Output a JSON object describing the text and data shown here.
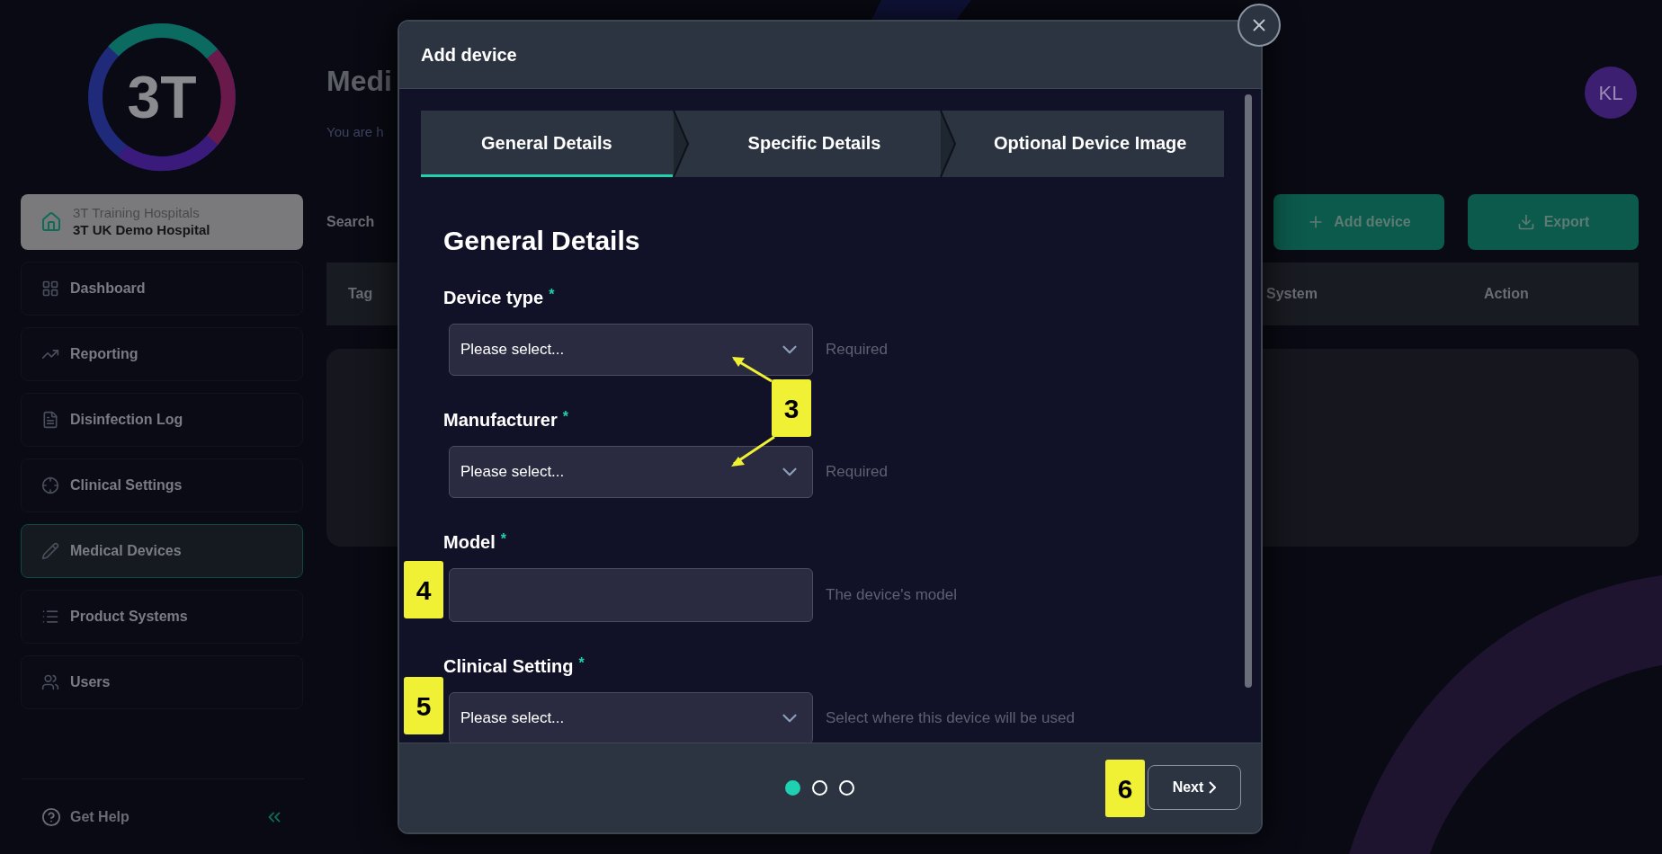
{
  "sidebar": {
    "logo_text": "3T",
    "hospital": {
      "group": "3T Training Hospitals",
      "name": "3T UK Demo Hospital"
    },
    "items": [
      {
        "label": "Dashboard",
        "selected": false
      },
      {
        "label": "Reporting",
        "selected": false
      },
      {
        "label": "Disinfection Log",
        "selected": false
      },
      {
        "label": "Clinical Settings",
        "selected": false
      },
      {
        "label": "Medical Devices",
        "selected": true
      },
      {
        "label": "Product Systems",
        "selected": false
      },
      {
        "label": "Users",
        "selected": false
      }
    ],
    "help": "Get Help"
  },
  "page": {
    "title": "Medi",
    "subtitle": "You are h",
    "avatar": "KL",
    "search_label": "Search",
    "buttons": [
      {
        "label": "Add device"
      },
      {
        "label": "Export"
      }
    ],
    "table": {
      "columns": [
        "Tag",
        "System",
        "Action"
      ]
    }
  },
  "modal": {
    "title": "Add device",
    "steps": [
      {
        "label": "General Details",
        "selected": true
      },
      {
        "label": "Specific Details",
        "selected": false
      },
      {
        "label": "Optional Device Image",
        "selected": false
      }
    ],
    "heading": "General Details",
    "fields": [
      {
        "kind": "select",
        "label": "Device type",
        "required_mark": "*",
        "value": "Please select...",
        "hint": "Required"
      },
      {
        "kind": "select",
        "label": "Manufacturer",
        "required_mark": "*",
        "value": "Please select...",
        "hint": "Required"
      },
      {
        "kind": "text",
        "label": "Model",
        "required_mark": "*",
        "hint": "The device's model"
      },
      {
        "kind": "select",
        "label": "Clinical Setting",
        "required_mark": "*",
        "value": "Please select...",
        "hint": "Select where this device will be used"
      }
    ],
    "pager": [
      {
        "selected": true
      },
      {
        "selected": false
      },
      {
        "selected": false
      }
    ],
    "next": "Next"
  },
  "annotations": [
    {
      "label": "3"
    },
    {
      "label": "4"
    },
    {
      "label": "5"
    },
    {
      "label": "6"
    }
  ]
}
